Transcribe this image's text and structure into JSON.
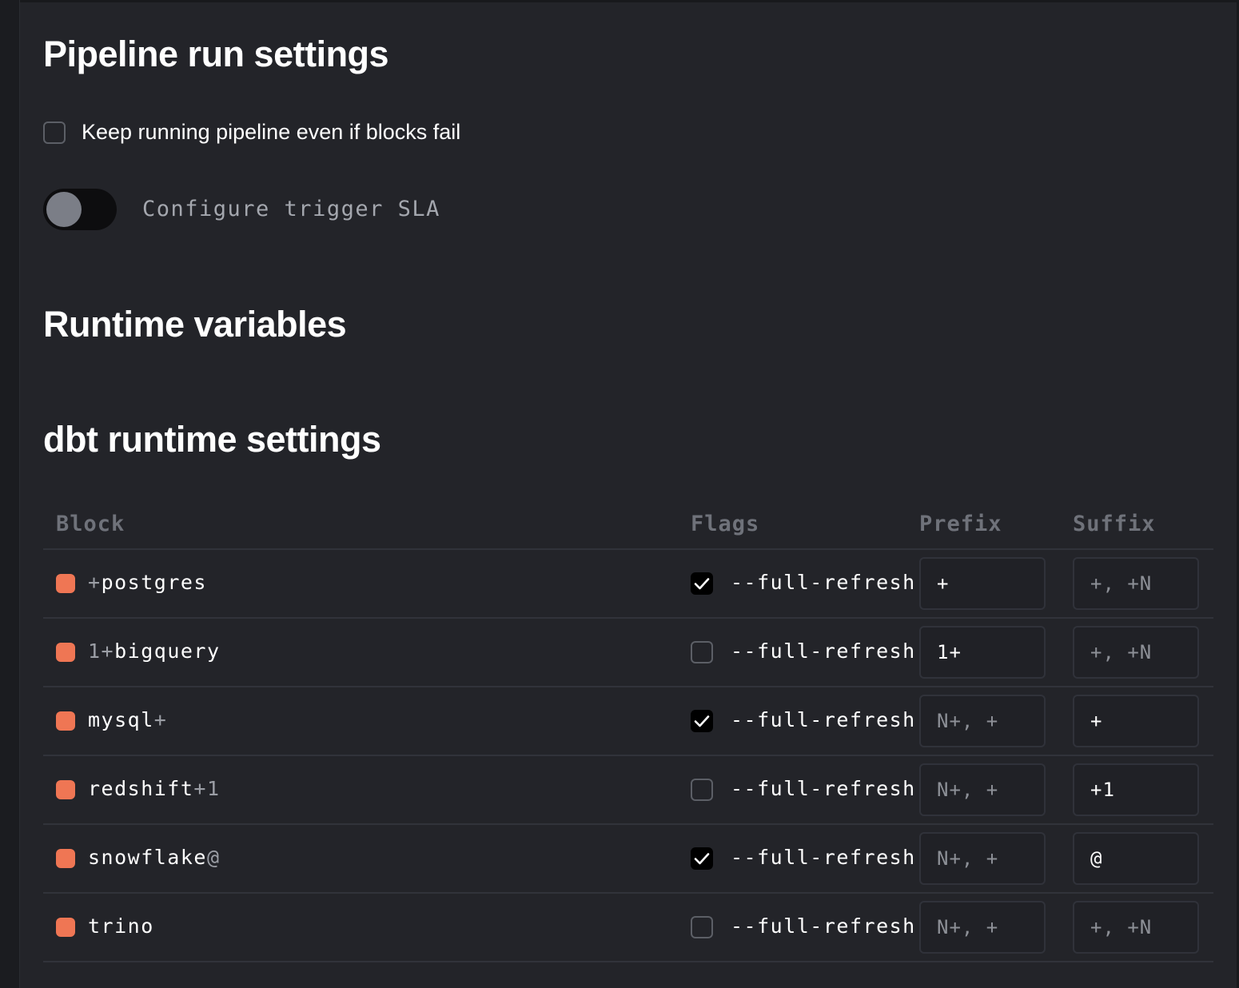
{
  "pipeline_run_settings": {
    "title": "Pipeline run settings",
    "keep_running_label": "Keep running pipeline even if blocks fail",
    "keep_running_checked": false,
    "sla_toggle_label": "Configure trigger SLA",
    "sla_toggle_on": false
  },
  "runtime_variables": {
    "title": "Runtime variables"
  },
  "dbt_runtime_settings": {
    "title": "dbt runtime settings",
    "columns": {
      "block": "Block",
      "flags": "Flags",
      "prefix": "Prefix",
      "suffix": "Suffix"
    },
    "rows": [
      {
        "prefix_part": "+",
        "name": "postgres",
        "suffix_part": "",
        "flag_checked": true,
        "flag_label": "--full-refresh",
        "prefix_value": "+",
        "prefix_placeholder": "",
        "suffix_value": "",
        "suffix_placeholder": "+, +N"
      },
      {
        "prefix_part": "1+",
        "name": "bigquery",
        "suffix_part": "",
        "flag_checked": false,
        "flag_label": "--full-refresh",
        "prefix_value": "1+",
        "prefix_placeholder": "",
        "suffix_value": "",
        "suffix_placeholder": "+, +N"
      },
      {
        "prefix_part": "",
        "name": "mysql",
        "suffix_part": "+",
        "flag_checked": true,
        "flag_label": "--full-refresh",
        "prefix_value": "",
        "prefix_placeholder": "N+, +",
        "suffix_value": "+",
        "suffix_placeholder": ""
      },
      {
        "prefix_part": "",
        "name": "redshift",
        "suffix_part": "+1",
        "flag_checked": false,
        "flag_label": "--full-refresh",
        "prefix_value": "",
        "prefix_placeholder": "N+, +",
        "suffix_value": "+1",
        "suffix_placeholder": ""
      },
      {
        "prefix_part": "",
        "name": "snowflake",
        "suffix_part": "@",
        "flag_checked": true,
        "flag_label": "--full-refresh",
        "prefix_value": "",
        "prefix_placeholder": "N+, +",
        "suffix_value": "@",
        "suffix_placeholder": ""
      },
      {
        "prefix_part": "",
        "name": "trino",
        "suffix_part": "",
        "flag_checked": false,
        "flag_label": "--full-refresh",
        "prefix_value": "",
        "prefix_placeholder": "N+, +",
        "suffix_value": "",
        "suffix_placeholder": "+, +N"
      }
    ]
  },
  "colors": {
    "block_dot": "#ef7654",
    "panel_background": "#232429",
    "checked_box": "#000000"
  }
}
